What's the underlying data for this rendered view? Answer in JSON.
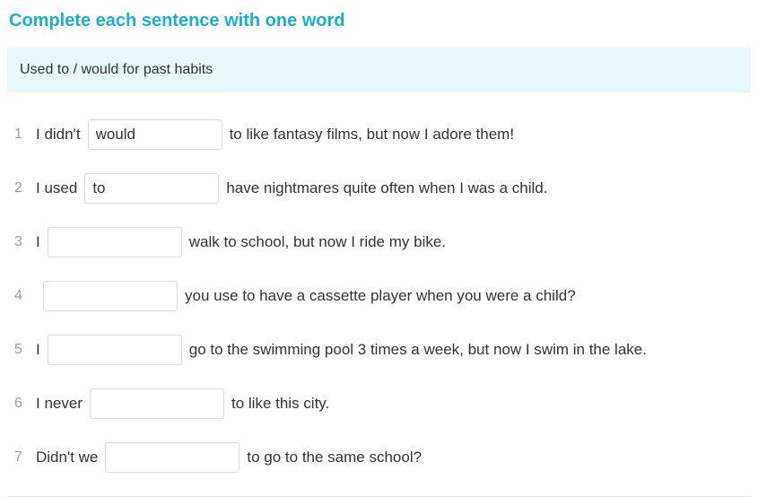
{
  "title": "Complete each sentence with one word",
  "banner": "Used to / would for past habits",
  "items": [
    {
      "num": "1",
      "before": "I didn't",
      "value": "would",
      "after": "to like fantasy films, but now I adore them!"
    },
    {
      "num": "2",
      "before": "I used",
      "value": "to",
      "after": "have nightmares quite often when I was a child."
    },
    {
      "num": "3",
      "before": "I",
      "value": "",
      "after": "walk to school, but now I ride my bike."
    },
    {
      "num": "4",
      "before": "",
      "value": "",
      "after": "you use to have a cassette player when you were a child?"
    },
    {
      "num": "5",
      "before": "I",
      "value": "",
      "after": "go to the swimming pool 3 times a week, but now I swim in the lake."
    },
    {
      "num": "6",
      "before": "I never",
      "value": "",
      "after": "to like this city."
    },
    {
      "num": "7",
      "before": "Didn't we",
      "value": "",
      "after": "to go to the same school?"
    }
  ]
}
